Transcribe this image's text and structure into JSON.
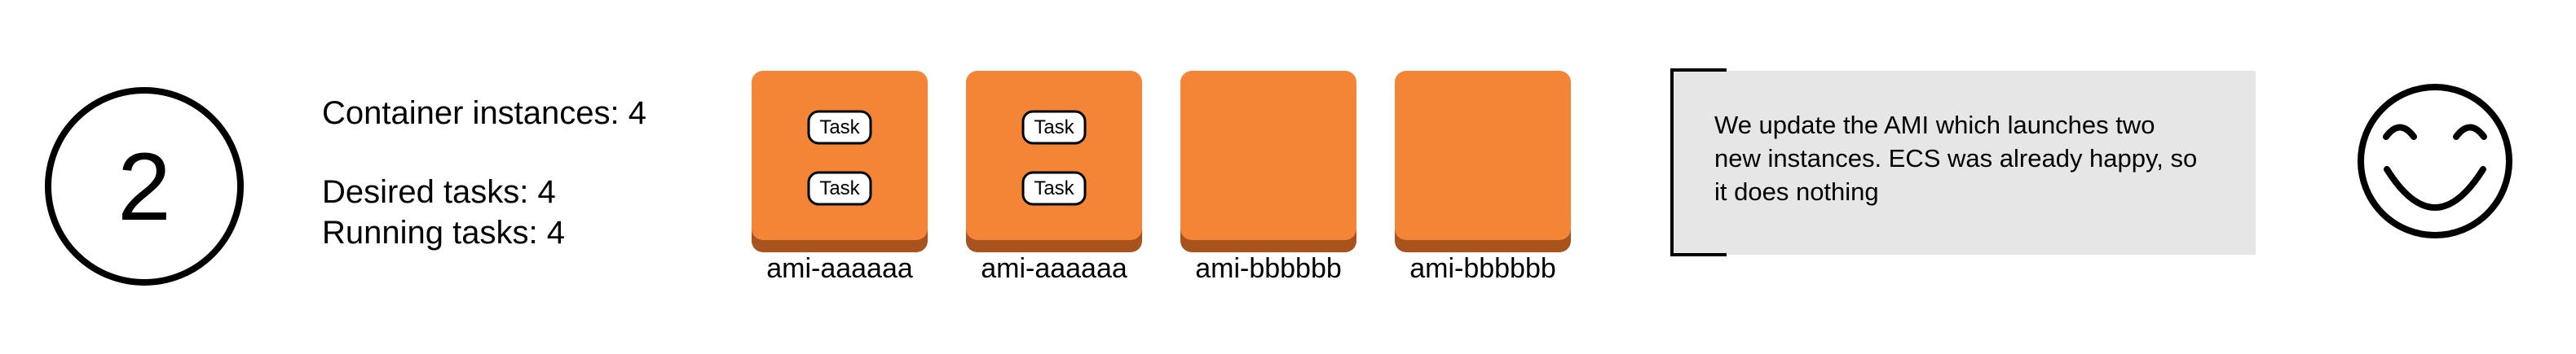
{
  "step": {
    "number": "2"
  },
  "stats": {
    "container_instances": "Container instances: 4",
    "desired_tasks": "Desired tasks: 4",
    "running_tasks": "Running tasks: 4"
  },
  "instances": [
    {
      "label": "ami-aaaaaa",
      "tasks": [
        "Task",
        "Task"
      ]
    },
    {
      "label": "ami-aaaaaa",
      "tasks": [
        "Task",
        "Task"
      ]
    },
    {
      "label": "ami-bbbbbb",
      "tasks": []
    },
    {
      "label": "ami-bbbbbb",
      "tasks": []
    }
  ],
  "note": {
    "lines": [
      "We update the AMI which launches two",
      "new instances. ECS was already happy, so",
      "it does nothing"
    ]
  },
  "status": {
    "icon": "smiley-face-icon"
  },
  "colors": {
    "instance_fill": "#F58536",
    "instance_shadow": "#A8521E",
    "note_fill": "#E6E6E6",
    "line": "#000000"
  }
}
